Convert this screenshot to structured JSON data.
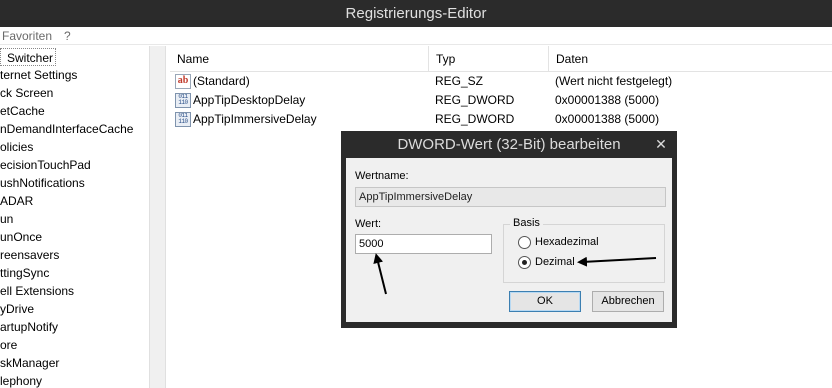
{
  "window": {
    "title": "Registrierungs-Editor"
  },
  "menu": {
    "items": [
      "Favoriten",
      "?"
    ]
  },
  "tree": {
    "items": [
      "Switcher",
      "ternet Settings",
      "ck Screen",
      "etCache",
      "nDemandInterfaceCache",
      "olicies",
      "ecisionTouchPad",
      "ushNotifications",
      "ADAR",
      "un",
      "unOnce",
      "reensavers",
      "ttingSync",
      "ell Extensions",
      "yDrive",
      "artupNotify",
      "ore",
      "skManager",
      "lephony"
    ]
  },
  "list": {
    "columns": [
      "Name",
      "Typ",
      "Daten"
    ],
    "rows": [
      {
        "icon": "string-value-icon",
        "icon_text": "ab",
        "name": "(Standard)",
        "type": "REG_SZ",
        "data": "(Wert nicht festgelegt)"
      },
      {
        "icon": "binary-value-icon",
        "icon_text": "011 110",
        "name": "AppTipDesktopDelay",
        "type": "REG_DWORD",
        "data": "0x00001388 (5000)"
      },
      {
        "icon": "binary-value-icon",
        "icon_text": "011 110",
        "name": "AppTipImmersiveDelay",
        "type": "REG_DWORD",
        "data": "0x00001388 (5000)"
      }
    ]
  },
  "dialog": {
    "title": "DWORD-Wert (32-Bit) bearbeiten",
    "close_glyph": "✕",
    "name_label": "Wertname:",
    "name_value": "AppTipImmersiveDelay",
    "value_label": "Wert:",
    "value_value": "5000",
    "base_label": "Basis",
    "base_options": [
      "Hexadezimal",
      "Dezimal"
    ],
    "base_selected": "Dezimal",
    "ok_label": "OK",
    "cancel_label": "Abbrechen"
  },
  "annotations": {
    "arrow_color": "#000000"
  }
}
